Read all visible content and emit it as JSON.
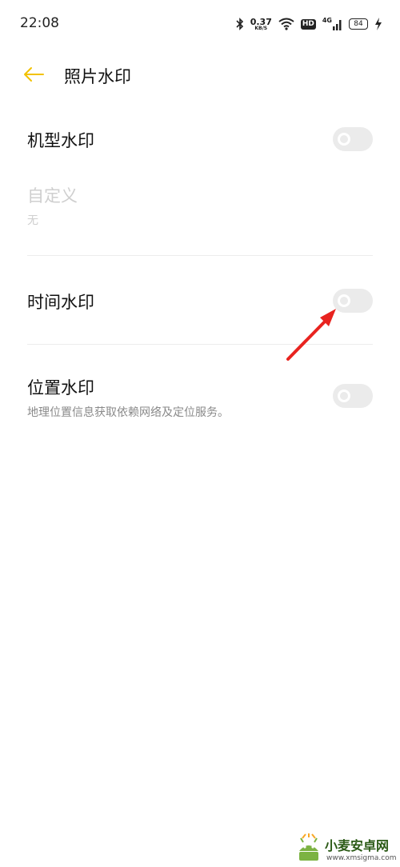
{
  "status_bar": {
    "time": "22:08",
    "net_speed_value": "0.37",
    "net_speed_unit": "KB/S",
    "hd_label": "HD",
    "network_label": "4G",
    "battery_level": "84",
    "icons": [
      "bluetooth-icon",
      "wifi-icon",
      "cellular-signal-icon",
      "charging-icon"
    ]
  },
  "header": {
    "title": "照片水印",
    "back_icon": "back-arrow-icon",
    "accent_color": "#F2C200"
  },
  "settings": {
    "model_watermark": {
      "title": "机型水印",
      "enabled": false
    },
    "custom": {
      "title": "自定义",
      "value": "无",
      "disabled": true
    },
    "time_watermark": {
      "title": "时间水印",
      "enabled": false
    },
    "location_watermark": {
      "title": "位置水印",
      "subtitle": "地理位置信息获取依赖网络及定位服务。",
      "enabled": false
    }
  },
  "annotation": {
    "arrow_color": "#E8231F"
  },
  "watermark": {
    "name": "小麦安卓网",
    "url": "www.xmsigma.com"
  }
}
